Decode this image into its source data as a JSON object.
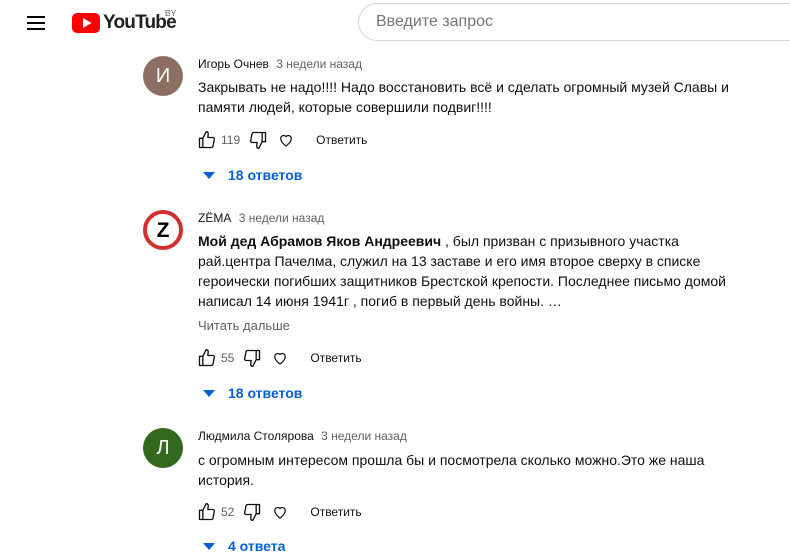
{
  "header": {
    "logo_text": "YouTube",
    "region": "BY",
    "search_placeholder": "Введите запрос"
  },
  "comments": [
    {
      "avatar_letter": "И",
      "avatar_color": "#8d6e63",
      "author": "Игорь Очнев",
      "time": "3 недели назад",
      "text_lines": [
        "Закрывать не надо!!!! Надо восстановить всё и сделать огромный музей Славы и",
        "памяти людей, которые совершили подвиг!!!!"
      ],
      "likes": "119",
      "reply_label": "Ответить",
      "replies_label": "18 ответов"
    },
    {
      "avatar_letter": "Z",
      "author": "ZЁMA",
      "time": "3 недели назад",
      "text_bold": "Мой дед Абрамов Яков Андреевич",
      "text_rest_first": " , был призван с призывного участка",
      "text_lines_rest": [
        "рай.центра Пачелма, служил на 13 заставе и его имя второе сверху в списке",
        "героически погибших защитников Брестской крепости. Последнее письмо домой",
        "написал 14 июня 1941г , погиб в первый день войны. …"
      ],
      "read_more": "Читать дальше",
      "likes": "55",
      "reply_label": "Ответить",
      "replies_label": "18 ответов"
    },
    {
      "avatar_letter": "Л",
      "avatar_color": "#33691e",
      "author": "Людмила Столярова",
      "time": "3 недели назад",
      "text_lines": [
        "с огромным  интересом прошла бы и посмотрела сколько можно.Это же наша",
        "история."
      ],
      "likes": "52",
      "reply_label": "Ответить",
      "replies_label": "4 ответа"
    }
  ],
  "icons": {
    "menu": "hamburger-menu-icon",
    "logo": "youtube-logo-icon",
    "like": "thumb-up-icon",
    "dislike": "thumb-down-icon",
    "heart": "heart-icon",
    "expand": "triangle-down-icon"
  },
  "colors": {
    "accent_blue": "#065fd4",
    "youtube_red": "#ff0000",
    "z_red": "#d32f2f"
  }
}
